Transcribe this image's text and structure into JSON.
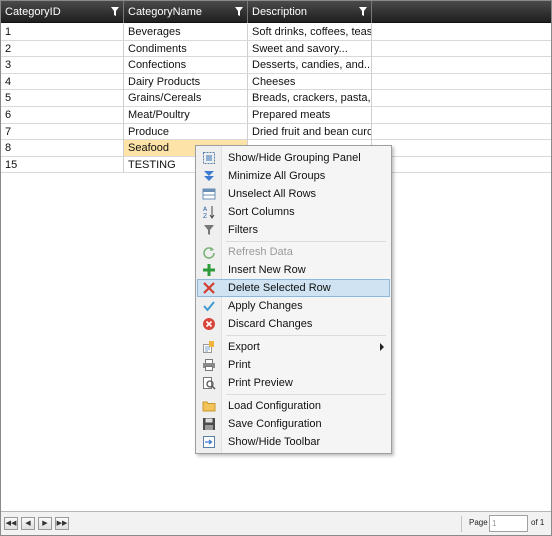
{
  "grid": {
    "columns": [
      {
        "label": "CategoryID"
      },
      {
        "label": "CategoryName"
      },
      {
        "label": "Description"
      }
    ],
    "rows": [
      {
        "id": "1",
        "name": "Beverages",
        "desc": "Soft drinks, coffees, teas,..."
      },
      {
        "id": "2",
        "name": "Condiments",
        "desc": "Sweet and savory..."
      },
      {
        "id": "3",
        "name": "Confections",
        "desc": "Desserts, candies, and..."
      },
      {
        "id": "4",
        "name": "Dairy Products",
        "desc": "Cheeses"
      },
      {
        "id": "5",
        "name": "Grains/Cereals",
        "desc": "Breads, crackers, pasta,..."
      },
      {
        "id": "6",
        "name": "Meat/Poultry",
        "desc": "Prepared meats"
      },
      {
        "id": "7",
        "name": "Produce",
        "desc": "Dried fruit and bean curd"
      },
      {
        "id": "8",
        "name": "Seafood",
        "desc": ""
      },
      {
        "id": "15",
        "name": "TESTING",
        "desc": ""
      }
    ],
    "selected_row_index": 7
  },
  "context_menu": {
    "items": [
      {
        "label": "Show/Hide Grouping Panel",
        "icon": "grouping-panel-icon"
      },
      {
        "label": "Minimize All Groups",
        "icon": "minimize-groups-icon"
      },
      {
        "label": "Unselect All Rows",
        "icon": "unselect-rows-icon"
      },
      {
        "label": "Sort Columns",
        "icon": "sort-az-icon"
      },
      {
        "label": "Filters",
        "icon": "filter-icon"
      },
      {
        "label": "Refresh Data",
        "icon": "refresh-icon",
        "disabled": true
      },
      {
        "label": "Insert New Row",
        "icon": "plus-icon"
      },
      {
        "label": "Delete Selected Row",
        "icon": "delete-x-icon",
        "highlighted": true
      },
      {
        "label": "Apply Changes",
        "icon": "checkmark-icon"
      },
      {
        "label": "Discard Changes",
        "icon": "discard-icon"
      },
      {
        "label": "Export",
        "icon": "export-icon",
        "submenu": true
      },
      {
        "label": "Print",
        "icon": "printer-icon"
      },
      {
        "label": "Print Preview",
        "icon": "print-preview-icon"
      },
      {
        "label": "Load Configuration",
        "icon": "folder-icon"
      },
      {
        "label": "Save Configuration",
        "icon": "save-disk-icon"
      },
      {
        "label": "Show/Hide Toolbar",
        "icon": "toolbar-icon"
      }
    ]
  },
  "pager": {
    "page_label": "Page",
    "current_page": "1",
    "of_label": "of 1"
  },
  "colors": {
    "header_bg": "#2a2a2a",
    "selected_cell": "#fde3a7",
    "menu_highlight": "#cfe3f2"
  }
}
